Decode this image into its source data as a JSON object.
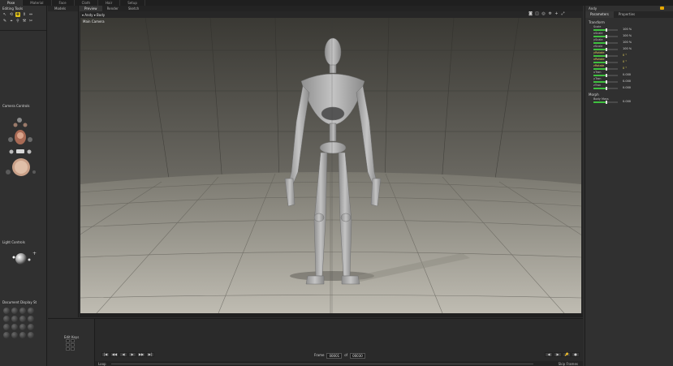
{
  "room_tabs": [
    "Pose",
    "Material",
    "Face",
    "Cloth",
    "Hair",
    "Setup"
  ],
  "left_panel": {
    "editing_tools_title": "Editing Tools",
    "tool_row1": [
      "↖",
      "⟲",
      "✥",
      "⇕",
      "⇔"
    ],
    "tool_row2": [
      "✎",
      "⌖",
      "⚲",
      "⚒",
      "✂"
    ],
    "camera_controls_title": "Camera Controls",
    "light_controls_title": "Light Controls",
    "document_display_title": "Document Display St",
    "style_count": 16
  },
  "col2": {
    "header": "Models"
  },
  "viewport": {
    "tabs": [
      "Preview",
      "Render",
      "Sketch"
    ],
    "active_tab": "Preview",
    "toolbar_label": "▾ Andy ▾ Body",
    "camera_label": "Main Camera",
    "icons": [
      "camera-icon",
      "render-icon",
      "display-icon",
      "gear-icon",
      "plus-icon",
      "expand-icon"
    ]
  },
  "right_panel": {
    "header": "Andy",
    "tabs": [
      "Parameters",
      "Properties"
    ],
    "active_tab": "Parameters",
    "transform_title": "Transform",
    "params": [
      {
        "name": "Scale",
        "value": "100 %",
        "level": 0.5,
        "yellow": false
      },
      {
        "name": "xScale",
        "value": "100 %",
        "level": 0.5,
        "yellow": false
      },
      {
        "name": "yScale",
        "value": "100 %",
        "level": 0.5,
        "yellow": false
      },
      {
        "name": "zScale",
        "value": "100 %",
        "level": 0.5,
        "yellow": false
      },
      {
        "name": "yRotate",
        "value": "0 °",
        "level": 0.5,
        "yellow": true
      },
      {
        "name": "xRotate",
        "value": "0 °",
        "level": 0.5,
        "yellow": true
      },
      {
        "name": "zRotate",
        "value": "0 °",
        "level": 0.5,
        "yellow": true
      },
      {
        "name": "xTran",
        "value": "0.000",
        "level": 0.5,
        "yellow": false
      },
      {
        "name": "yTran",
        "value": "0.000",
        "level": 0.5,
        "yellow": false
      },
      {
        "name": "zTran",
        "value": "0.000",
        "level": 0.5,
        "yellow": false
      }
    ],
    "morph_title": "Morph",
    "morph_param": {
      "name": "Body Mass",
      "value": "0.000"
    }
  },
  "timeline": {
    "edit_keys_label": "Edit Keys",
    "transport": [
      "|◀",
      "◀◀",
      "◀",
      "▶",
      "▶▶",
      "▶|"
    ],
    "frame_label": "Frame",
    "frame_value": "00001",
    "of_label": "of",
    "frame_total": "00030",
    "right_buttons": [
      "◀",
      "▶",
      "🔑",
      "●"
    ],
    "loop_label": "Loop",
    "skip_label": "Skip Frames"
  },
  "colors": {
    "accent_yellow": "#e0c21a",
    "slider_green": "#3fbf3f",
    "badge_orange": "#e6a800"
  }
}
